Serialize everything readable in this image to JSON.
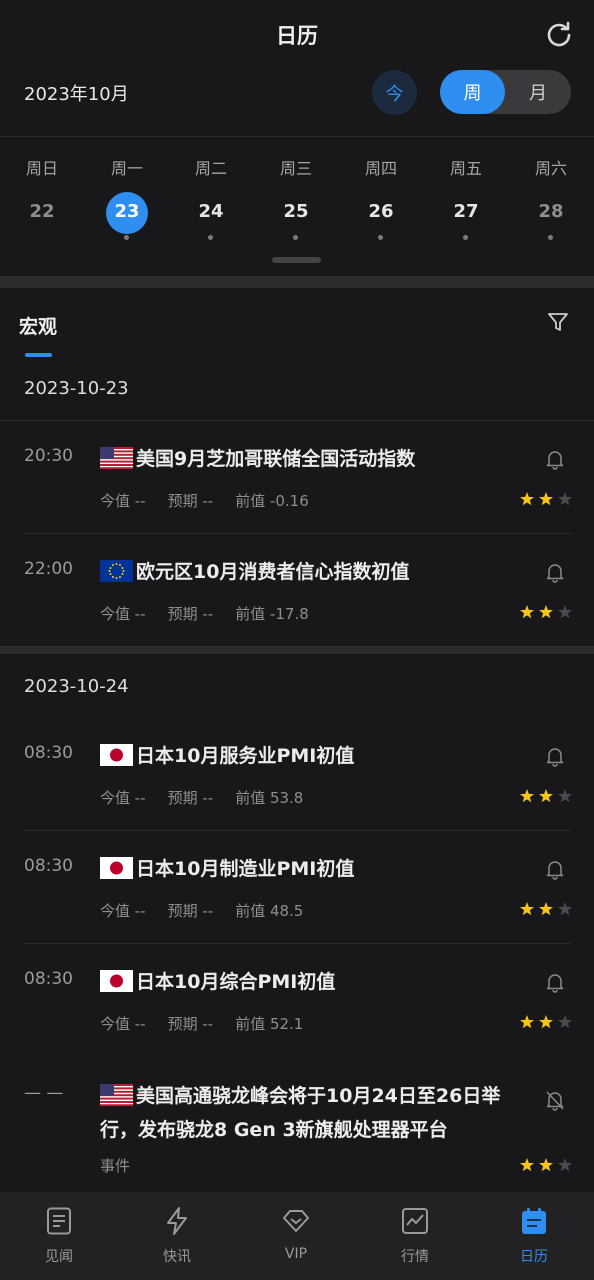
{
  "header": {
    "title": "日历",
    "month": "2023年10月",
    "today_label": "今",
    "toggle": {
      "week": "周",
      "month": "月",
      "selected": "周"
    }
  },
  "week": {
    "days": [
      {
        "weekday": "周日",
        "date": "22",
        "state": "muted"
      },
      {
        "weekday": "周一",
        "date": "23",
        "state": "selected"
      },
      {
        "weekday": "周二",
        "date": "24",
        "state": "normal"
      },
      {
        "weekday": "周三",
        "date": "25",
        "state": "normal"
      },
      {
        "weekday": "周四",
        "date": "26",
        "state": "normal"
      },
      {
        "weekday": "周五",
        "date": "27",
        "state": "normal"
      },
      {
        "weekday": "周六",
        "date": "28",
        "state": "muted"
      }
    ]
  },
  "section": {
    "title": "宏观"
  },
  "groups": [
    {
      "date": "2023-10-23",
      "events": [
        {
          "time": "20:30",
          "flag": "us-flag-icon",
          "title": "美国9月芝加哥联储全国活动指数",
          "actual": "今值 --",
          "forecast": "预期 --",
          "previous": "前值 -0.16",
          "stars": 2
        },
        {
          "time": "22:00",
          "flag": "eu-flag-icon",
          "title": "欧元区10月消费者信心指数初值",
          "actual": "今值 --",
          "forecast": "预期 --",
          "previous": "前值 -17.8",
          "stars": 2
        }
      ]
    },
    {
      "date": "2023-10-24",
      "events": [
        {
          "time": "08:30",
          "flag": "jp-flag-icon",
          "title": "日本10月服务业PMI初值",
          "actual": "今值 --",
          "forecast": "预期 --",
          "previous": "前值 53.8",
          "stars": 2
        },
        {
          "time": "08:30",
          "flag": "jp-flag-icon",
          "title": "日本10月制造业PMI初值",
          "actual": "今值 --",
          "forecast": "预期 --",
          "previous": "前值 48.5",
          "stars": 2
        },
        {
          "time": "08:30",
          "flag": "jp-flag-icon",
          "title": "日本10月综合PMI初值",
          "actual": "今值 --",
          "forecast": "预期 --",
          "previous": "前值 52.1",
          "stars": 2
        },
        {
          "time": "— —",
          "flag": "us-flag-icon",
          "title": "美国高通骁龙峰会将于10月24日至26日举行，发布骁龙8 Gen 3新旗舰处理器平台",
          "tag": "事件",
          "stars": 2,
          "bell": "bell-off-icon"
        }
      ]
    }
  ],
  "tabbar": {
    "items": [
      {
        "label": "见闻",
        "icon": "news-icon"
      },
      {
        "label": "快讯",
        "icon": "lightning-icon"
      },
      {
        "label": "VIP",
        "icon": "diamond-icon"
      },
      {
        "label": "行情",
        "icon": "chart-icon"
      },
      {
        "label": "日历",
        "icon": "calendar-icon"
      }
    ],
    "active": "日历"
  },
  "colors": {
    "accent": "#2f8ff0",
    "background": "#18181a",
    "star": "#f5c518"
  }
}
